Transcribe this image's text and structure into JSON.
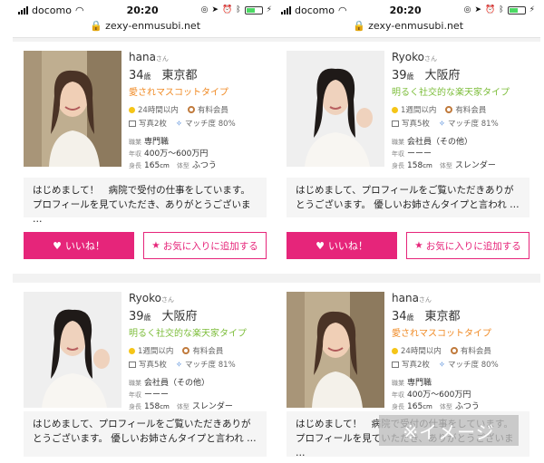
{
  "statusbar": {
    "carrier": "docomo",
    "time": "20:20"
  },
  "url": "zexy-enmusubi.net",
  "colors": {
    "accent": "#e6257a",
    "orange_type": "#f08a24",
    "green_type": "#7cbd3a"
  },
  "profiles": {
    "hana": {
      "name": "hana",
      "honorific": "さん",
      "age": "34",
      "age_unit": "歳",
      "prefecture": "東京都",
      "type": "愛されマスコットタイプ",
      "login": "24時間以内",
      "member": "有料会員",
      "photos": "写真2枚",
      "match": "マッチ度 80%",
      "job_label": "職業",
      "job": "専門職",
      "income_label": "年収",
      "income": "400万〜600万円",
      "height_label": "身長",
      "height": "165",
      "height_unit": "cm",
      "body_label": "体型",
      "body": "ふつう",
      "message_l1": "はじめまして！　病院で受付の仕事をしています。",
      "message_l2": "プロフィールを見ていただき、ありがとうございま …"
    },
    "ryoko": {
      "name": "Ryoko",
      "honorific": "さん",
      "age": "39",
      "age_unit": "歳",
      "prefecture": "大阪府",
      "type": "明るく社交的な楽天家タイプ",
      "login": "1週間以内",
      "member": "有料会員",
      "photos": "写真5枚",
      "match": "マッチ度 81%",
      "job_label": "職業",
      "job": "会社員（その他）",
      "income_label": "年収",
      "income": "ーーー",
      "height_label": "身長",
      "height": "158",
      "height_unit": "cm",
      "body_label": "体型",
      "body": "スレンダー",
      "message_l1": "はじめまして、プロフィールをご覧いただきありが",
      "message_l2": "とうございます。 優しいお姉さんタイプと言われ …"
    }
  },
  "buttons": {
    "like": "いいね！",
    "favorite": "お気に入りに追加する"
  },
  "image_note": "※イメージ"
}
